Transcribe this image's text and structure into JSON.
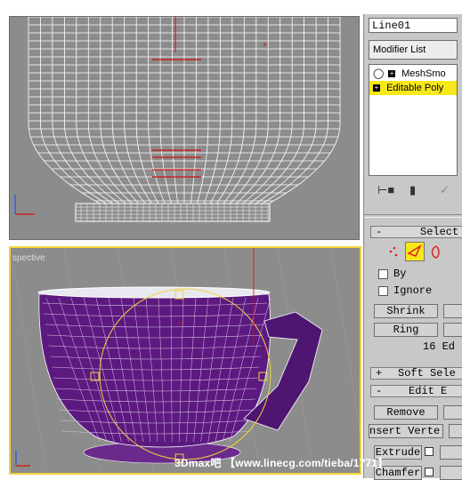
{
  "viewports": {
    "front": {
      "label": ""
    },
    "perspective": {
      "label": "spective"
    }
  },
  "panel": {
    "object_name": "Line01",
    "modifier_list_label": "Modifier List",
    "stack": [
      {
        "label": "MeshSmo",
        "icon": "lightbulb-icon",
        "selected": false
      },
      {
        "label": "Editable Poly",
        "icon": "plus-icon",
        "selected": true
      }
    ],
    "tool_icons": [
      "pin-stack-icon",
      "show-end-result-icon",
      "make-unique-icon"
    ]
  },
  "selection_rollout": {
    "sign": "-",
    "title": "Select",
    "subobject_icons": [
      "vertex-icon",
      "edge-icon",
      "border-icon"
    ],
    "by_label": "By",
    "ignore_label": "Ignore",
    "shrink_label": "Shrink",
    "ring_label": "Ring",
    "status": "16 Ed"
  },
  "soft_selection_rollout": {
    "sign": "+",
    "title": "Soft Sele"
  },
  "edit_edges_rollout": {
    "sign": "-",
    "title": "Edit E",
    "remove_label": "Remove",
    "insert_vertex_label": "nsert Verte",
    "extrude_label": "Extrude",
    "chamfer_label": "Chamfer"
  },
  "watermark": {
    "brand": "3Dmax吧",
    "text": "【www.linecg.com/tieba/1771】"
  },
  "colors": {
    "viewport_bg": "#8c8c8c",
    "cup_purple": "#5c1a80",
    "active_border": "#f3d23a",
    "selected_stack": "#f7e81a"
  }
}
